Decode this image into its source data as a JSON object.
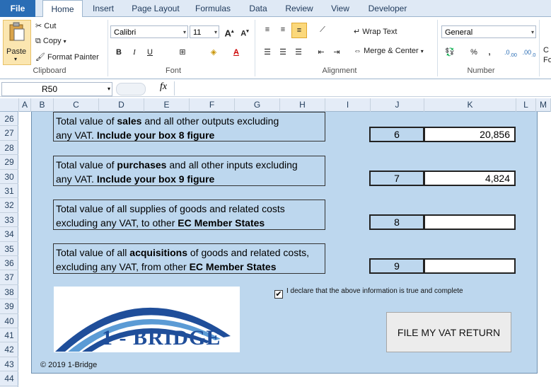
{
  "tabs": [
    "File",
    "Home",
    "Insert",
    "Page Layout",
    "Formulas",
    "Data",
    "Review",
    "View",
    "Developer"
  ],
  "ribbon": {
    "clipboard": {
      "paste": "Paste",
      "cut": "Cut",
      "copy": "Copy",
      "format_painter": "Format Painter",
      "label": "Clipboard"
    },
    "font": {
      "name": "Calibri",
      "size": "11",
      "bold": "B",
      "italic": "I",
      "underline": "U",
      "label": "Font",
      "grow": "A",
      "shrink": "A"
    },
    "alignment": {
      "wrap_text": "Wrap Text",
      "merge_center": "Merge & Center",
      "label": "Alignment"
    },
    "number": {
      "format": "General",
      "percent": "%",
      "comma": ",",
      "inc": ".0→.00",
      "dec": ".00→.0",
      "label": "Number"
    },
    "styles_partial": "C\nFo"
  },
  "formula_bar": {
    "name_box": "R50",
    "fx": "fx",
    "value": ""
  },
  "columns": [
    "A",
    "B",
    "C",
    "D",
    "E",
    "F",
    "G",
    "H",
    "I",
    "J",
    "K",
    "L",
    "M"
  ],
  "rows": [
    "26",
    "27",
    "28",
    "29",
    "30",
    "31",
    "32",
    "33",
    "34",
    "35",
    "36",
    "37",
    "38",
    "39",
    "40",
    "41",
    "42",
    "43",
    "44"
  ],
  "questions": [
    {
      "pre": "Total value of ",
      "bold1": "sales",
      "mid": " and all other outputs excluding",
      "line2_pre": "any VAT. ",
      "line2_bold": "Include your box 8 figure",
      "box": "6",
      "value": "20,856"
    },
    {
      "pre": "Total value of ",
      "bold1": "purchases",
      "mid": " and all other inputs excluding",
      "line2_pre": "any VAT. ",
      "line2_bold": "Include your box 9 figure",
      "box": "7",
      "value": "4,824"
    },
    {
      "pre": "Total value of all supplies of goods and related costs",
      "bold1": "",
      "mid": "",
      "line2_pre": "excluding any VAT, to other ",
      "line2_bold": "EC Member States",
      "box": "8",
      "value": ""
    },
    {
      "pre": "Total value of all ",
      "bold1": "acquisitions",
      "mid": " of goods and related costs,",
      "line2_pre": "excluding any VAT, from other ",
      "line2_bold": "EC Member States",
      "box": "9",
      "value": ""
    }
  ],
  "logo_text": "1 - BRIDGE",
  "declaration": "I declare that the above information is true and complete",
  "file_button": "FILE MY VAT RETURN",
  "copyright": "© 2019 1-Bridge",
  "colors": {
    "panel": "#bdd7ee",
    "logo_blue": "#1f4e9a",
    "logo_arch_light": "#5b9bd5"
  }
}
